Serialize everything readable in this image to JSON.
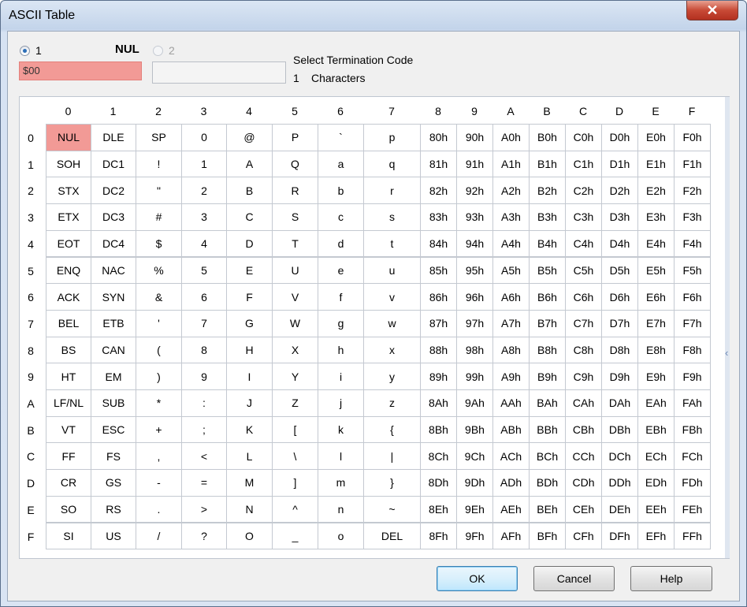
{
  "window": {
    "title": "ASCII Table",
    "close_glyph": "✕"
  },
  "selector": {
    "option1_label": "1",
    "option1_char": "NUL",
    "option1_value": "$00",
    "option2_label": "2",
    "option2_value": "",
    "selected": 1
  },
  "termination": {
    "title": "Select Termination Code",
    "count": "1",
    "count_label": "Characters"
  },
  "grid": {
    "col_headers": [
      "0",
      "1",
      "2",
      "3",
      "4",
      "5",
      "6",
      "7",
      "8",
      "9",
      "A",
      "B",
      "C",
      "D",
      "E",
      "F"
    ],
    "row_headers": [
      "0",
      "1",
      "2",
      "3",
      "4",
      "5",
      "6",
      "7",
      "8",
      "9",
      "A",
      "B",
      "C",
      "D",
      "E",
      "F"
    ],
    "selected": {
      "row": 0,
      "col": 0
    },
    "rows": [
      [
        "NUL",
        "DLE",
        "SP",
        "0",
        "@",
        "P",
        "`",
        "p",
        "80h",
        "90h",
        "A0h",
        "B0h",
        "C0h",
        "D0h",
        "E0h",
        "F0h"
      ],
      [
        "SOH",
        "DC1",
        "!",
        "1",
        "A",
        "Q",
        "a",
        "q",
        "81h",
        "91h",
        "A1h",
        "B1h",
        "C1h",
        "D1h",
        "E1h",
        "F1h"
      ],
      [
        "STX",
        "DC2",
        "\"",
        "2",
        "B",
        "R",
        "b",
        "r",
        "82h",
        "92h",
        "A2h",
        "B2h",
        "C2h",
        "D2h",
        "E2h",
        "F2h"
      ],
      [
        "ETX",
        "DC3",
        "#",
        "3",
        "C",
        "S",
        "c",
        "s",
        "83h",
        "93h",
        "A3h",
        "B3h",
        "C3h",
        "D3h",
        "E3h",
        "F3h"
      ],
      [
        "EOT",
        "DC4",
        "$",
        "4",
        "D",
        "T",
        "d",
        "t",
        "84h",
        "94h",
        "A4h",
        "B4h",
        "C4h",
        "D4h",
        "E4h",
        "F4h"
      ],
      [
        "ENQ",
        "NAC",
        "%",
        "5",
        "E",
        "U",
        "e",
        "u",
        "85h",
        "95h",
        "A5h",
        "B5h",
        "C5h",
        "D5h",
        "E5h",
        "F5h"
      ],
      [
        "ACK",
        "SYN",
        "&",
        "6",
        "F",
        "V",
        "f",
        "v",
        "86h",
        "96h",
        "A6h",
        "B6h",
        "C6h",
        "D6h",
        "E6h",
        "F6h"
      ],
      [
        "BEL",
        "ETB",
        "'",
        "7",
        "G",
        "W",
        "g",
        "w",
        "87h",
        "97h",
        "A7h",
        "B7h",
        "C7h",
        "D7h",
        "E7h",
        "F7h"
      ],
      [
        "BS",
        "CAN",
        "(",
        "8",
        "H",
        "X",
        "h",
        "x",
        "88h",
        "98h",
        "A8h",
        "B8h",
        "C8h",
        "D8h",
        "E8h",
        "F8h"
      ],
      [
        "HT",
        "EM",
        ")",
        "9",
        "I",
        "Y",
        "i",
        "y",
        "89h",
        "99h",
        "A9h",
        "B9h",
        "C9h",
        "D9h",
        "E9h",
        "F9h"
      ],
      [
        "LF/NL",
        "SUB",
        "*",
        ":",
        "J",
        "Z",
        "j",
        "z",
        "8Ah",
        "9Ah",
        "AAh",
        "BAh",
        "CAh",
        "DAh",
        "EAh",
        "FAh"
      ],
      [
        "VT",
        "ESC",
        "+",
        ";",
        "K",
        "[",
        "k",
        "{",
        "8Bh",
        "9Bh",
        "ABh",
        "BBh",
        "CBh",
        "DBh",
        "EBh",
        "FBh"
      ],
      [
        "FF",
        "FS",
        ",",
        "<",
        "L",
        "\\",
        "l",
        "|",
        "8Ch",
        "9Ch",
        "ACh",
        "BCh",
        "CCh",
        "DCh",
        "ECh",
        "FCh"
      ],
      [
        "CR",
        "GS",
        "-",
        "=",
        "M",
        "]",
        "m",
        "}",
        "8Dh",
        "9Dh",
        "ADh",
        "BDh",
        "CDh",
        "DDh",
        "EDh",
        "FDh"
      ],
      [
        "SO",
        "RS",
        ".",
        ">",
        "N",
        "^",
        "n",
        "~",
        "8Eh",
        "9Eh",
        "AEh",
        "BEh",
        "CEh",
        "DEh",
        "EEh",
        "FEh"
      ],
      [
        "SI",
        "US",
        "/",
        "?",
        "O",
        "_",
        "o",
        "DEL",
        "8Fh",
        "9Fh",
        "AFh",
        "BFh",
        "CFh",
        "DFh",
        "EFh",
        "FFh"
      ]
    ]
  },
  "buttons": {
    "ok": "OK",
    "cancel": "Cancel",
    "help": "Help"
  },
  "colors": {
    "selected_cell": "#f29a96",
    "value_field": "#f29a96",
    "title_gradient_top": "#dbe6f4"
  },
  "icons": {
    "scroll_hint": "chevron-left-icon"
  }
}
